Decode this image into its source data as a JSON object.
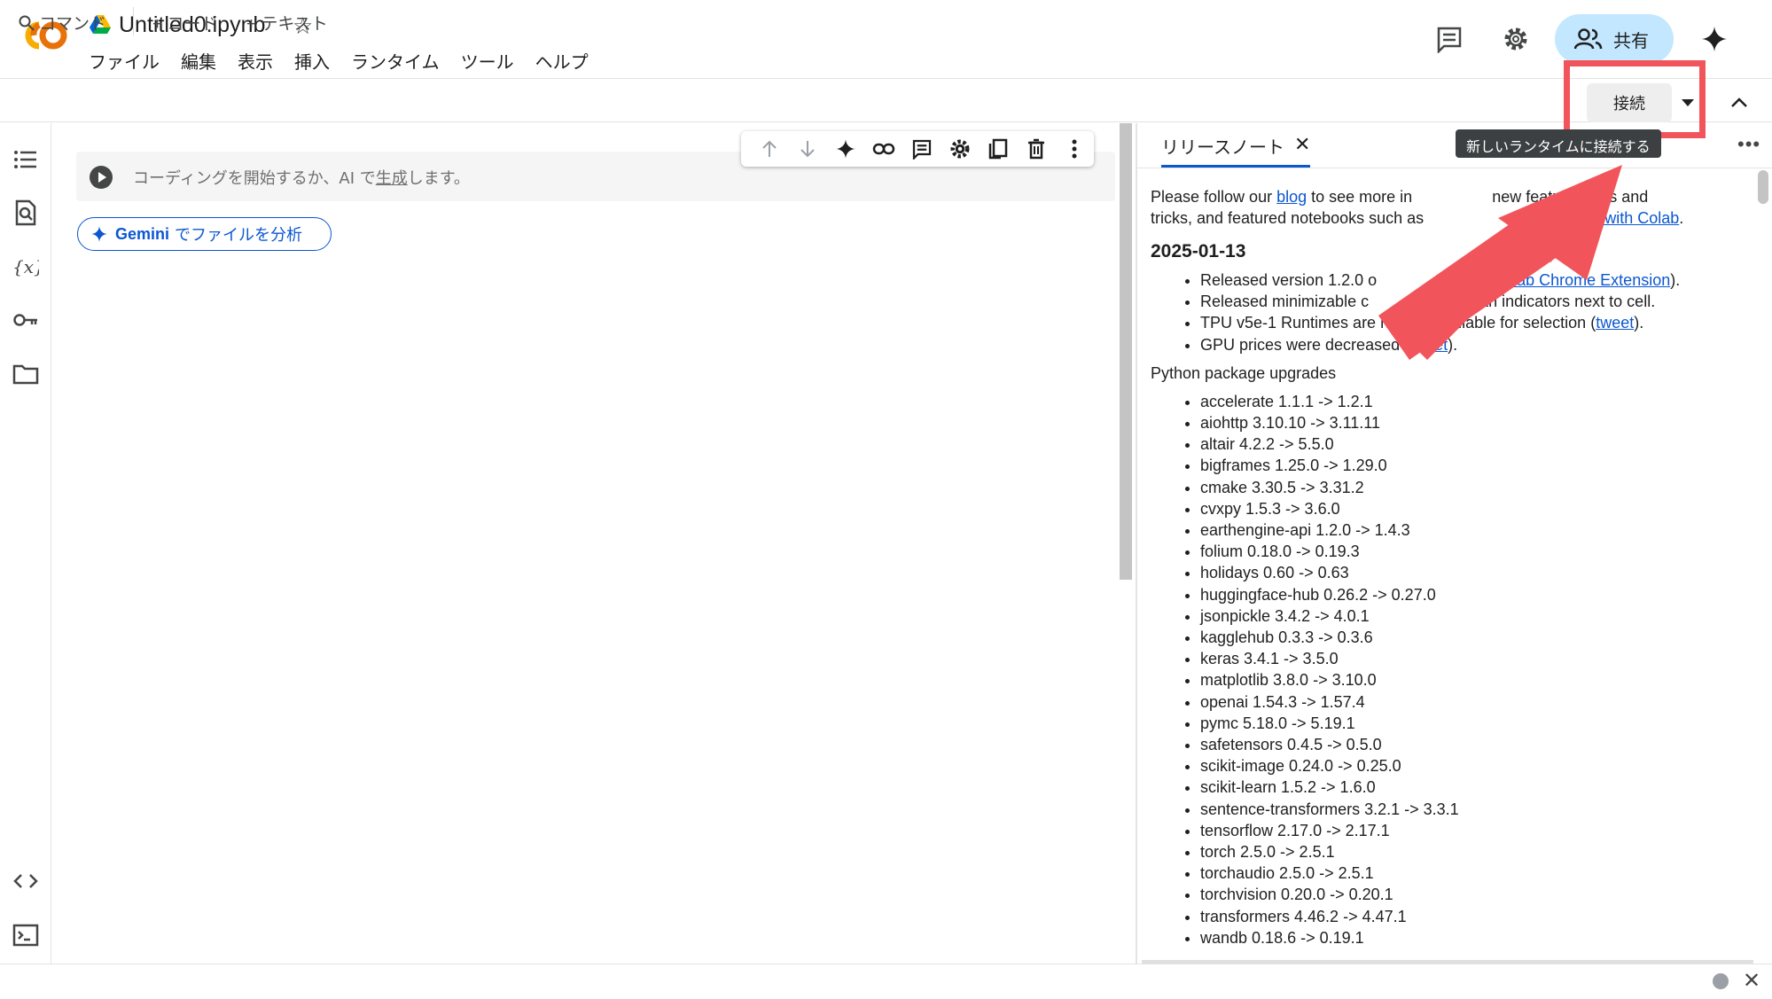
{
  "header": {
    "title": "Untitled0.ipynb",
    "menu": [
      "ファイル",
      "編集",
      "表示",
      "挿入",
      "ランタイム",
      "ツール",
      "ヘルプ"
    ],
    "share_label": "共有"
  },
  "toolbar": {
    "command_label": "コマンド",
    "code_label": "+ コード",
    "text_label": "+ テキスト",
    "connect_label": "接続",
    "connect_tooltip": "新しいランタイムに接続する"
  },
  "cell": {
    "placeholder_prefix": "コーディングを開始するか、AI で",
    "placeholder_link": "生成",
    "placeholder_suffix": "します。"
  },
  "gemini_button": {
    "brand": "Gemini",
    "label": "でファイルを分析"
  },
  "panel": {
    "tab_label": "リリースノート",
    "intro_before_blog": "Please follow our",
    "blog_link": "blog",
    "intro_visible_1": "to see more in",
    "intro_visible_2": "new features, tips and",
    "intro_line2_before": "tricks, and featured notebooks such as",
    "intro_link_visible": "ank Failure with Colab",
    "date": "2025-01-13",
    "release_items": [
      {
        "before": "Released version 1.2.0 o",
        "link": "r Colab Chrome Extension",
        "after": ")."
      },
      {
        "before": "Released minimizable c",
        "link": "",
        "after": " with indicators next to cell."
      },
      {
        "before": "TPU v5e-1 Runtimes are n",
        "link": "",
        "after": " available for selection ("
      },
      {
        "before": "GPU prices were decreased (",
        "link": "tweet",
        "after": ")."
      }
    ],
    "tpu_link": "tweet",
    "tpu_after": ").",
    "packages_heading": "Python package upgrades",
    "packages": [
      "accelerate 1.1.1 -> 1.2.1",
      "aiohttp 3.10.10 -> 3.11.11",
      "altair 4.2.2 -> 5.5.0",
      "bigframes 1.25.0 -> 1.29.0",
      "cmake 3.30.5 -> 3.31.2",
      "cvxpy 1.5.3 -> 3.6.0",
      "earthengine-api 1.2.0 -> 1.4.3",
      "folium 0.18.0 -> 0.19.3",
      "holidays 0.60 -> 0.63",
      "huggingface-hub 0.26.2 -> 0.27.0",
      "jsonpickle 3.4.2 -> 4.0.1",
      "kagglehub 0.3.3 -> 0.3.6",
      "keras 3.4.1 -> 3.5.0",
      "matplotlib 3.8.0 -> 3.10.0",
      "openai 1.54.3 -> 1.57.4",
      "pymc 5.18.0 -> 5.19.1",
      "safetensors 0.4.5 -> 0.5.0",
      "scikit-image 0.24.0 -> 0.25.0",
      "scikit-learn 1.5.2 -> 1.6.0",
      "sentence-transformers 3.2.1 -> 3.3.1",
      "tensorflow 2.17.0 -> 2.17.1",
      "torch 2.5.0 -> 2.5.1",
      "torchaudio 2.5.0 -> 2.5.1",
      "torchvision 0.20.0 -> 0.20.1",
      "transformers 4.46.2 -> 4.47.1",
      "wandb 0.18.6 -> 0.19.1"
    ]
  },
  "colors": {
    "accent": "#0b57d0",
    "share_bg": "#c2e7ff",
    "highlight": "#f2545b",
    "logo_orange": "#f9ab00",
    "logo_dark_orange": "#e8710a"
  },
  "icons": [
    "colab-logo-icon",
    "drive-icon",
    "star-icon",
    "comment-icon",
    "settings-icon",
    "people-icon",
    "gemini-sparkle-icon",
    "search-icon",
    "caret-down-icon",
    "chevron-up-icon",
    "toc-icon",
    "find-icon",
    "variables-icon",
    "key-icon",
    "folder-icon",
    "code-snippets-icon",
    "terminal-icon",
    "play-icon",
    "arrow-up-icon",
    "arrow-down-icon",
    "sparkle-icon",
    "link-icon",
    "comment-icon",
    "gear-icon",
    "mirror-icon",
    "trash-icon",
    "more-vert-icon",
    "close-icon",
    "more-horiz-icon"
  ]
}
